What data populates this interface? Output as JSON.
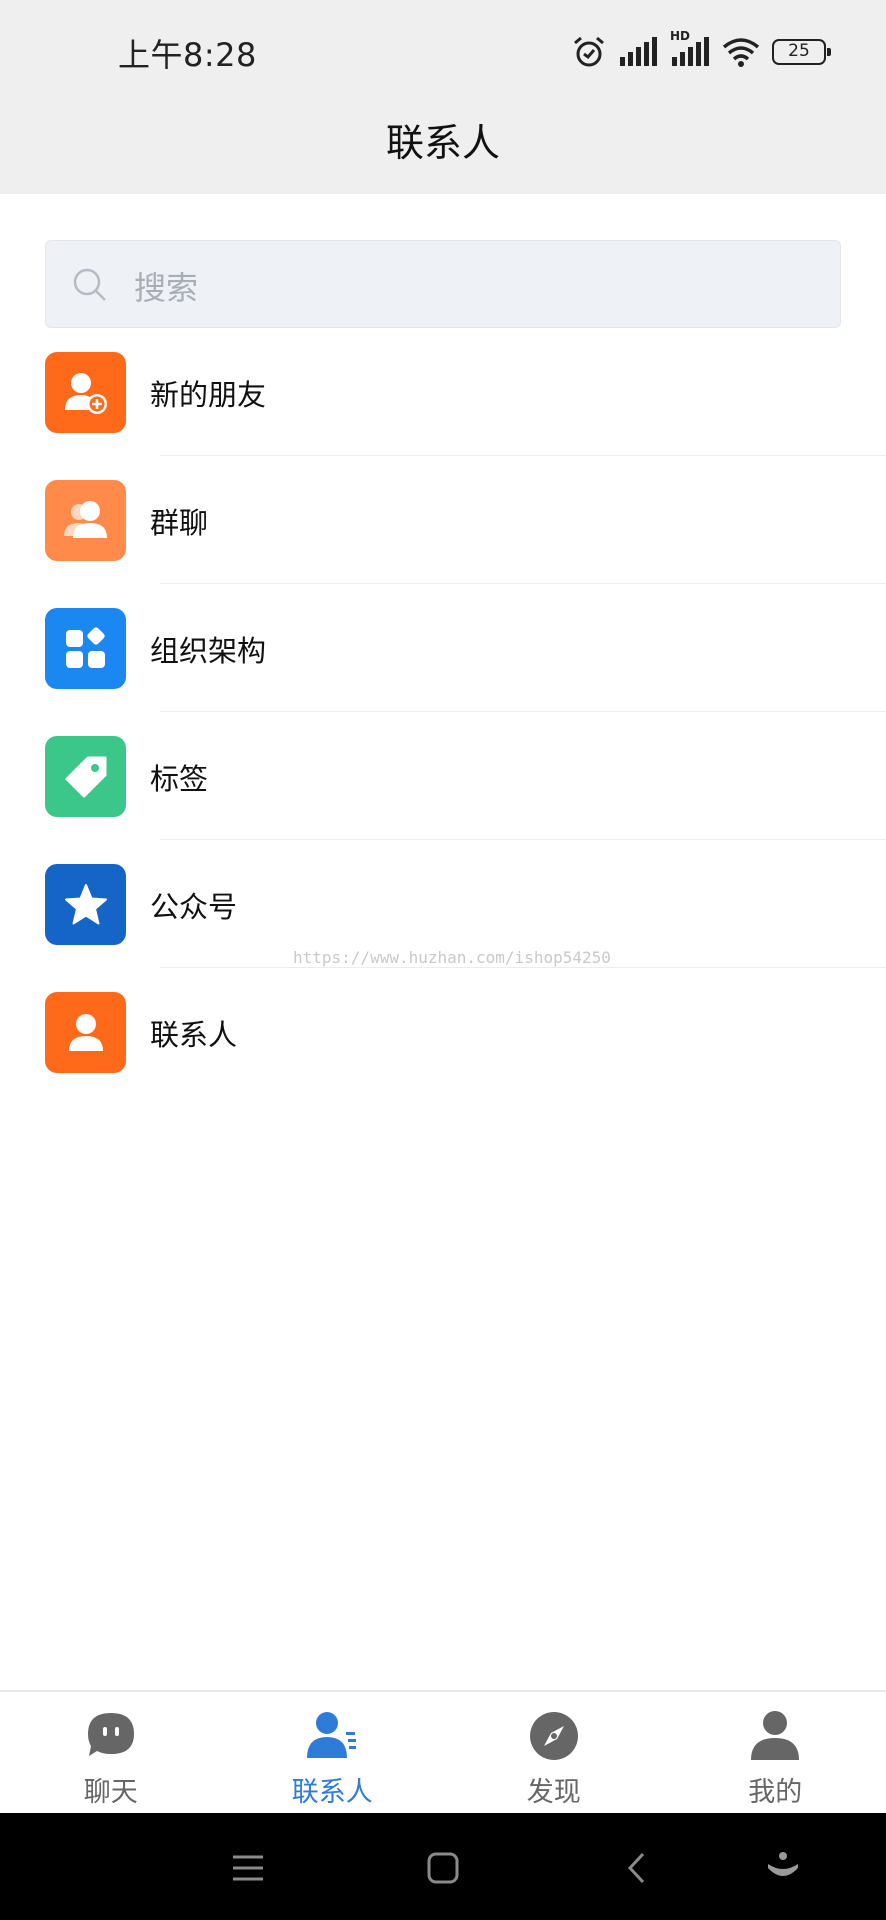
{
  "status_bar": {
    "time": "上午8:28",
    "battery": "25",
    "network_label": "HD"
  },
  "header": {
    "title": "联系人"
  },
  "search": {
    "placeholder": "搜索"
  },
  "entries": [
    {
      "label": "新的朋友",
      "icon": "add-friend-icon",
      "color": "#ff6a1a"
    },
    {
      "label": "群聊",
      "icon": "group-chat-icon",
      "color": "#ff8a4a"
    },
    {
      "label": "组织架构",
      "icon": "organization-icon",
      "color": "#1a88f0"
    },
    {
      "label": "标签",
      "icon": "tag-icon",
      "color": "#3cc78a"
    },
    {
      "label": "公众号",
      "icon": "star-icon",
      "color": "#1565c8"
    },
    {
      "label": "联系人",
      "icon": "contact-icon",
      "color": "#ff6a1a"
    }
  ],
  "watermark": "https://www.huzhan.com/ishop54250",
  "tabs": [
    {
      "label": "聊天",
      "icon": "chat-icon",
      "active": false
    },
    {
      "label": "联系人",
      "icon": "contacts-icon",
      "active": true
    },
    {
      "label": "发现",
      "icon": "compass-icon",
      "active": false
    },
    {
      "label": "我的",
      "icon": "profile-icon",
      "active": false
    }
  ],
  "colors": {
    "accent": "#2e7bd8",
    "tab_inactive": "#666666"
  }
}
